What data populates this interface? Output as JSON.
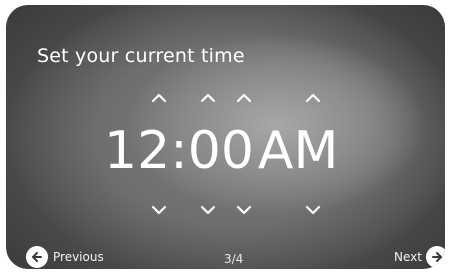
{
  "screen": {
    "title": "Set your current time"
  },
  "time": {
    "hour_tens": "1",
    "hour_ones": "2",
    "separator": ":",
    "minute_tens": "0",
    "minute_ones": "0",
    "period": "AM"
  },
  "footer": {
    "previous_label": "Previous",
    "page_indicator": "3/4",
    "next_label": "Next"
  },
  "icons": {
    "up": "chevron-up-icon",
    "down": "chevron-down-icon",
    "back": "arrow-left-icon",
    "forward": "arrow-right-icon"
  }
}
